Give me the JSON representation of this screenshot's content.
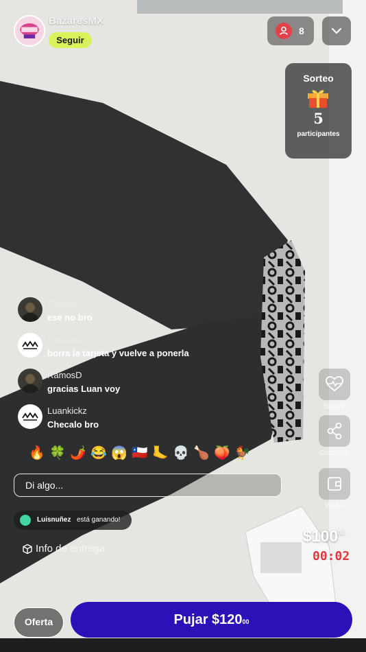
{
  "header": {
    "seller_name": "BazaresMX",
    "follow_label": "Seguir",
    "viewer_count": "8"
  },
  "giveaway": {
    "title": "Sorteo",
    "count": "5",
    "label": "participantes"
  },
  "chat": {
    "messages": [
      {
        "user": "RamosD",
        "text": "ese no bro"
      },
      {
        "user": "Luankickz",
        "text": "borra la tarjeta y vuelve a ponerla"
      },
      {
        "user": "RamosD",
        "text": "gracias Luan voy"
      },
      {
        "user": "Luankickz",
        "text": "Checalo bro"
      }
    ]
  },
  "reactions": [
    "🔥",
    "🍀",
    "🌶️",
    "😂",
    "😱",
    "🇨🇱",
    "🦶",
    "💀",
    "🍗",
    "🍑",
    "🐓"
  ],
  "comment_input": {
    "placeholder": "Di algo..."
  },
  "actions": {
    "support_label": "Soporte",
    "share_label": "Compartir",
    "wallet_label": "Wallet"
  },
  "winner": {
    "name": "Luisnuñez",
    "text": "está ganando!"
  },
  "delivery": {
    "label": "Info de entrega"
  },
  "price": {
    "amount": "$100",
    "cents": "00"
  },
  "timer": "00:02",
  "bottom": {
    "offer_label": "Oferta",
    "bid_label": "Pujar $120",
    "bid_cents": "00"
  },
  "colors": {
    "follow": "#d8f35a",
    "bid_button": "#2a12b8",
    "timer": "#e4343f",
    "viewer_icon": "#e2414a",
    "winner_dot": "#3fd6a2"
  }
}
